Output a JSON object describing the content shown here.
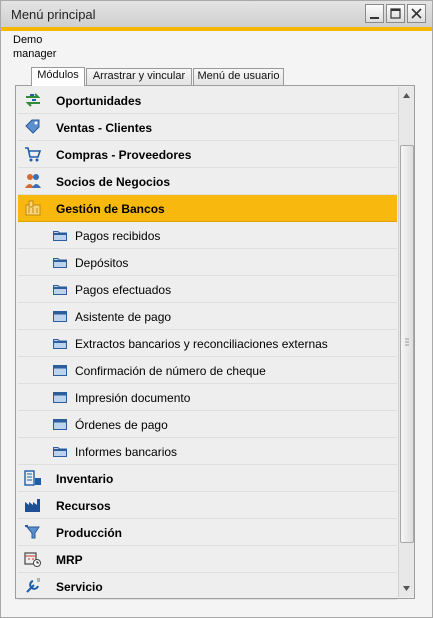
{
  "window": {
    "title": "Menú principal"
  },
  "user": {
    "line1": "Demo",
    "line2": "manager"
  },
  "tabs": [
    {
      "label": "Módulos",
      "active": true
    },
    {
      "label": "Arrastrar y vincular",
      "active": false
    },
    {
      "label": "Menú de usuario",
      "active": false
    }
  ],
  "modules": {
    "oportunidades": "Oportunidades",
    "ventas": "Ventas - Clientes",
    "compras": "Compras - Proveedores",
    "socios": "Socios de Negocios",
    "bancos": "Gestión de Bancos",
    "inventario": "Inventario",
    "recursos": "Recursos",
    "produccion": "Producción",
    "mrp": "MRP",
    "servicio": "Servicio"
  },
  "bancos_items": {
    "pagos_recibidos": "Pagos recibidos",
    "depositos": "Depósitos",
    "pagos_efectuados": "Pagos efectuados",
    "asistente_pago": "Asistente de pago",
    "extractos": "Extractos bancarios y reconciliaciones externas",
    "confirmacion_cheque": "Confirmación de número de cheque",
    "impresion_documento": "Impresión documento",
    "ordenes_pago": "Órdenes de pago",
    "informes_bancarios": "Informes bancarios"
  },
  "colors": {
    "accent": "#f5b800",
    "selected_row": "#f9b80e"
  },
  "selected_module": "Gestión de Bancos"
}
